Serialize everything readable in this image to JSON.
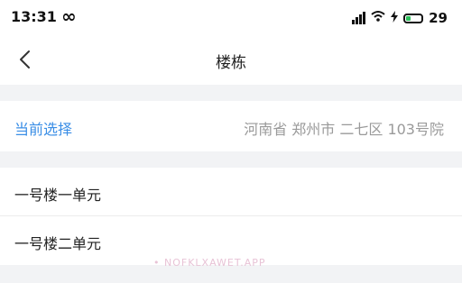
{
  "status_bar": {
    "time": "13:31",
    "infinity_symbol": "∞",
    "battery_level": "29",
    "battery_fill_fraction": 0.29,
    "icons": [
      "signal-icon",
      "wifi-icon",
      "charging-bolt-icon",
      "battery-icon"
    ]
  },
  "nav": {
    "back_icon": "chevron-left-icon",
    "title": "楼栋"
  },
  "current_selection": {
    "label": "当前选择",
    "value": "河南省 郑州市 二七区 103号院"
  },
  "list": {
    "items": [
      {
        "label": "一号楼一单元"
      },
      {
        "label": "一号楼二单元"
      }
    ]
  },
  "watermark": "• NOFKLXAWET.APP",
  "colors": {
    "accent": "#3a8ee6",
    "muted_text": "#9a9a9a",
    "background": "#f2f3f5",
    "battery_green": "#2bbf5a"
  }
}
